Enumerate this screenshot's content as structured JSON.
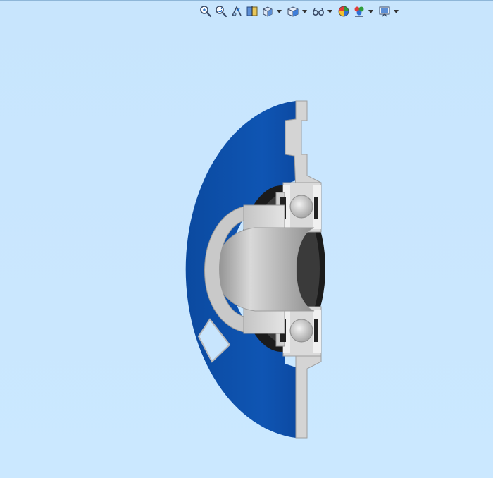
{
  "toolbar": {
    "buttons": [
      {
        "icon": "zoom-to-fit-icon",
        "has_dropdown": false
      },
      {
        "icon": "zoom-to-area-icon",
        "has_dropdown": false
      },
      {
        "icon": "previous-view-icon",
        "has_dropdown": false
      },
      {
        "icon": "section-view-icon",
        "has_dropdown": false
      },
      {
        "icon": "view-orientation-icon",
        "has_dropdown": true
      },
      {
        "icon": "display-style-icon",
        "has_dropdown": true
      },
      {
        "icon": "hide-show-items-icon",
        "has_dropdown": true
      },
      {
        "icon": "edit-appearance-icon",
        "has_dropdown": false
      },
      {
        "icon": "apply-scene-icon",
        "has_dropdown": true
      },
      {
        "icon": "view-settings-icon",
        "has_dropdown": true
      }
    ]
  },
  "colors": {
    "background": "#c9e6fd",
    "housing_blue": "#0f4fa8",
    "section_face": "#d6d6d6",
    "shaft_steel": "#b8b8b8",
    "bearing_dark": "#1e1e1e"
  }
}
